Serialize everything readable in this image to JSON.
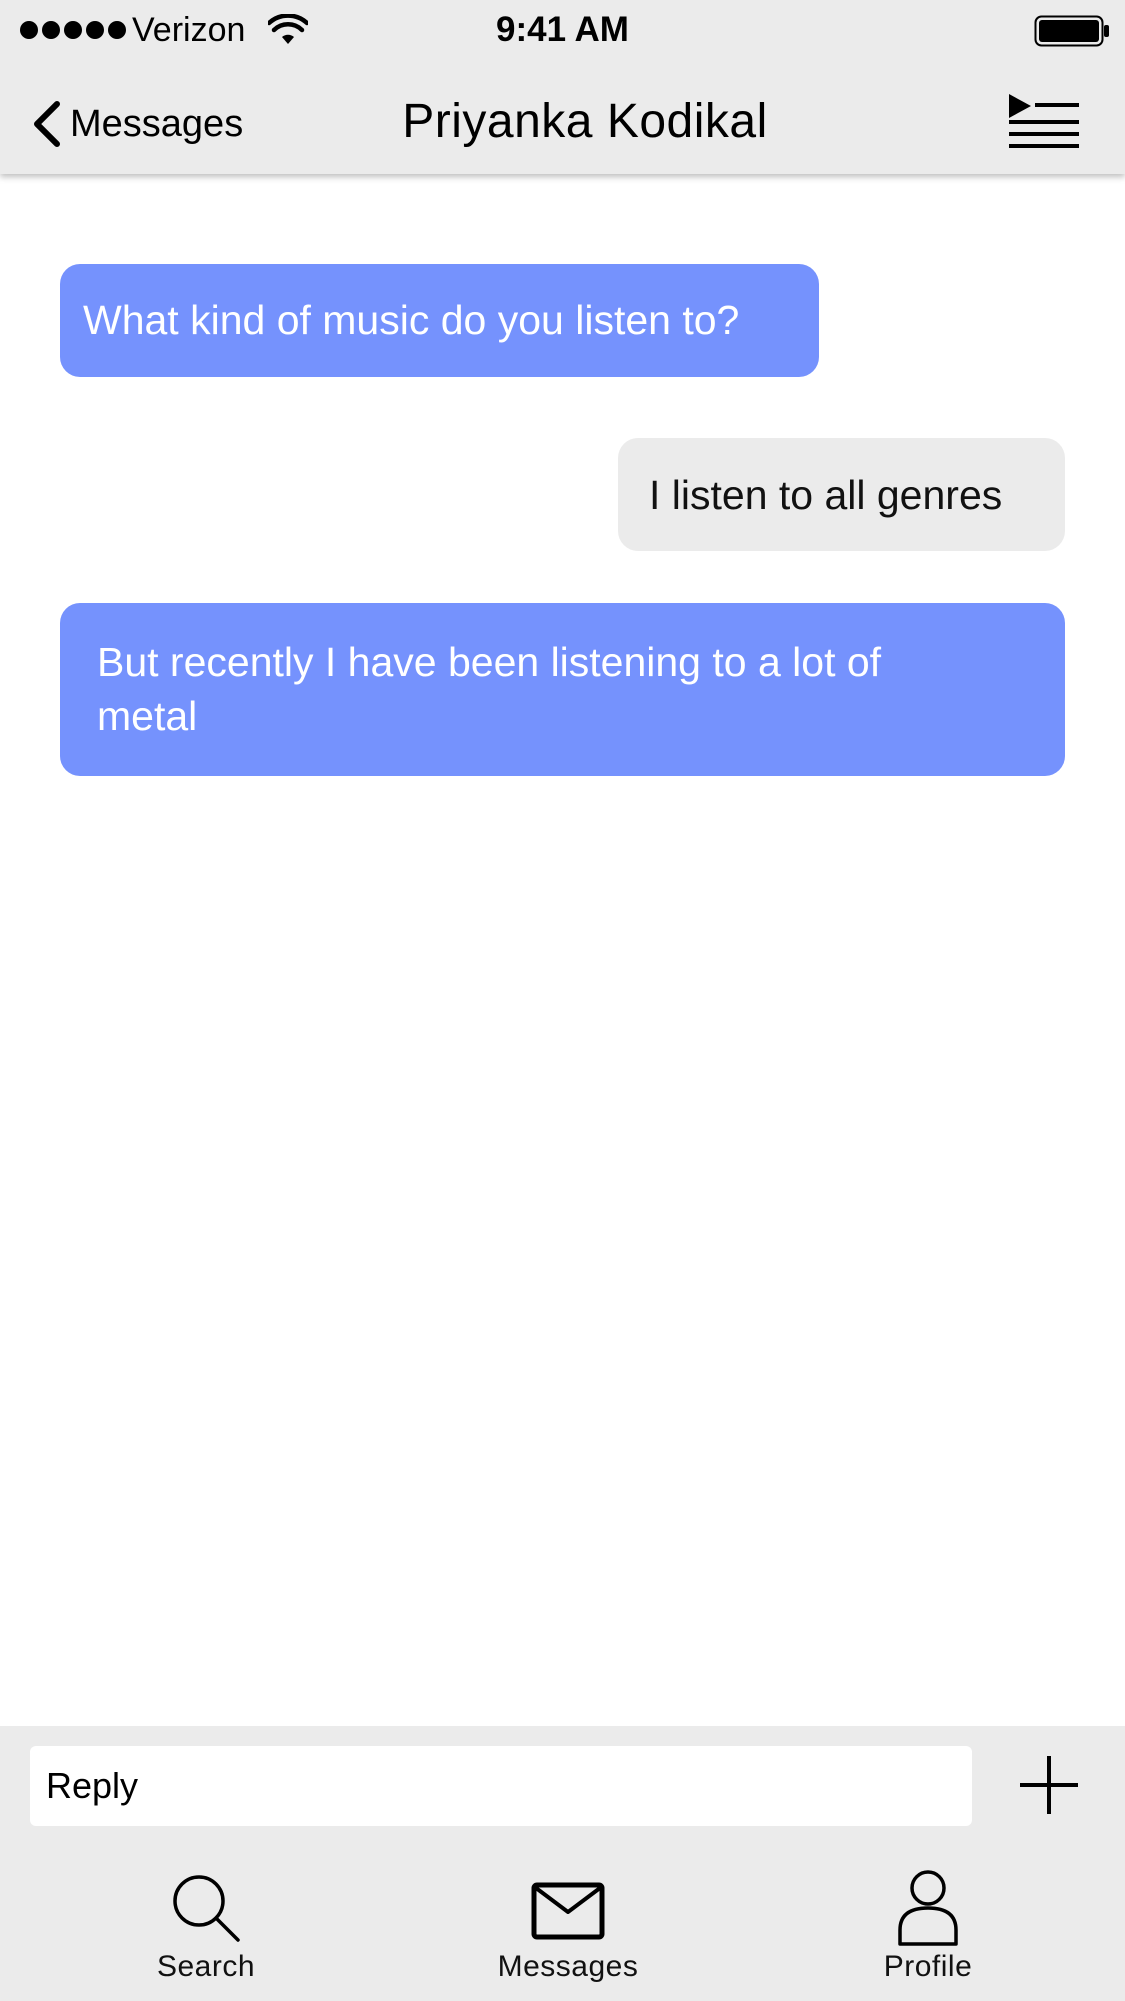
{
  "status_bar": {
    "carrier": "Verizon",
    "time": "9:41 AM",
    "signal_icon": "signal-dots-icon",
    "wifi_icon": "wifi-icon",
    "battery_icon": "battery-icon"
  },
  "nav": {
    "back_label": "Messages",
    "title": "Priyanka Kodikal",
    "back_icon": "chevron-left-icon",
    "action_icon": "playlist-icon"
  },
  "messages": [
    {
      "direction": "received",
      "text": "What kind of music do you listen to?"
    },
    {
      "direction": "sent",
      "text": "I listen to all genres"
    },
    {
      "direction": "received",
      "text": "But recently I have been listening to a lot of metal"
    }
  ],
  "reply": {
    "placeholder": "Reply",
    "add_icon": "plus-icon"
  },
  "tabs": [
    {
      "label": "Search",
      "icon": "search-icon"
    },
    {
      "label": "Messages",
      "icon": "envelope-icon"
    },
    {
      "label": "Profile",
      "icon": "person-icon"
    }
  ],
  "colors": {
    "received_bubble": "#7592fd",
    "sent_bubble": "#ebebeb",
    "bar_background": "#ebebeb"
  }
}
